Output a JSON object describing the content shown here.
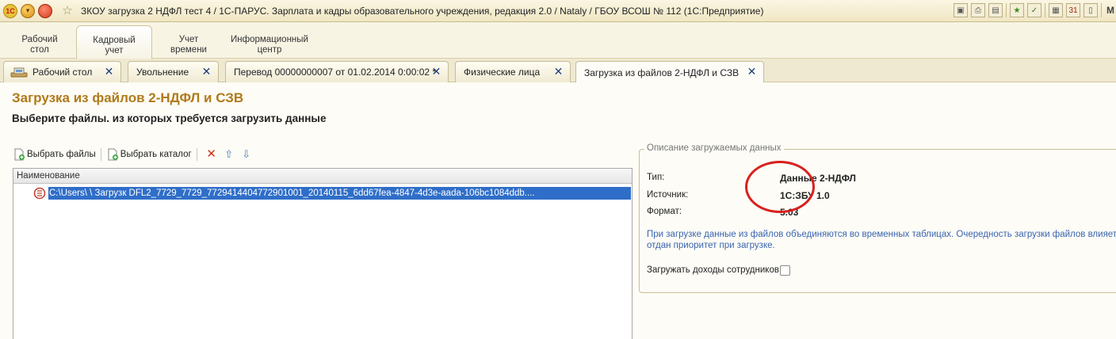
{
  "window": {
    "title": "ЗКОУ загрузка 2 НДФЛ тест 4 / 1С-ПАРУС. Зарплата и кадры образовательного учреждения, редакция 2.0 / Nataly / ГБОУ ВСОШ № 112  (1С:Предприятие)",
    "logo_text": "1С",
    "right_letter": "M"
  },
  "sections": [
    {
      "label": "Рабочий\nстол"
    },
    {
      "label": "Кадровый\nучет"
    },
    {
      "label": "Учет\nвремени"
    },
    {
      "label": "Информационный\nцентр"
    }
  ],
  "tabs": [
    {
      "label": "Рабочий стол"
    },
    {
      "label": "Увольнение"
    },
    {
      "label": "Перевод 00000000007 от 01.02.2014 0:00:02 *"
    },
    {
      "label": "Физические лица"
    },
    {
      "label": "Загрузка из файлов 2-НДФЛ и СЗВ"
    }
  ],
  "form": {
    "title": "Загрузка из файлов 2-НДФЛ и СЗВ",
    "subtitle": "Выберите файлы. из которых требуется загрузить данные",
    "toolbar": {
      "select_files": "Выбрать файлы",
      "select_catalog": "Выбрать каталог"
    },
    "grid": {
      "column": "Наименование",
      "rows": [
        "C:\\Users\\            \\          Загрузк              DFL2_7729_7729_7729414404772901001_20140115_6dd67fea-4847-4d3e-aada-106bc1084ddb...."
      ]
    },
    "description": {
      "title": "Описание загружаемых данных",
      "type_label": "Тип:",
      "type_value": "Данные 2-НДФЛ",
      "source_label": "Источник:",
      "source_value": "1С:ЗБУ 1.0",
      "format_label": "Формат:",
      "format_value": "5.03",
      "info_line1": "При загрузке данные из файлов объединяются во временных таблицах. Очередность загрузки файлов влияет на т",
      "info_line2": "отдан приоритет при загрузке.",
      "checkbox_label": "Загружать доходы сотрудников:",
      "checkbox_checked": false
    }
  }
}
